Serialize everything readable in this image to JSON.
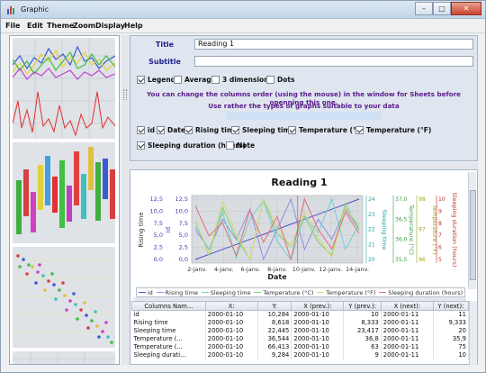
{
  "window": {
    "title": "Graphic",
    "minimize": "–",
    "maximize": "□",
    "close": "✕"
  },
  "menu": [
    "File",
    "Edit",
    "Theme",
    "Zoom",
    "Display",
    "Help"
  ],
  "form": {
    "title_label": "Title",
    "title_value": "Reading 1",
    "subtitle_label": "Subtitle",
    "subtitle_value": "",
    "options": [
      {
        "label": "Legend",
        "checked": true
      },
      {
        "label": "Average",
        "checked": false
      },
      {
        "label": "3 dimensions",
        "checked": false
      },
      {
        "label": "Dots",
        "checked": false
      }
    ],
    "info1": "You can change the columns order (using the mouse) in the window for Sheets before openning this one.",
    "info2": "Use rather the types of graphs suitable to your data",
    "columns": [
      {
        "label": "id",
        "checked": true
      },
      {
        "label": "Date",
        "checked": true
      },
      {
        "label": "Rising time",
        "checked": true
      },
      {
        "label": "Sleeping time",
        "checked": true
      },
      {
        "label": "Temperature (°C)",
        "checked": true
      },
      {
        "label": "Temperature (°F)",
        "checked": true
      },
      {
        "label": "Sleeping duration (hours)",
        "checked": true
      },
      {
        "label": "Note",
        "checked": false
      }
    ]
  },
  "chart_data": {
    "type": "line",
    "title": "Reading 1",
    "xlabel": "Date",
    "x": [
      "2-janv.",
      "4-janv.",
      "6-janv.",
      "8-janv.",
      "10-janv.",
      "12-janv.",
      "14-janv."
    ],
    "left_axes": [
      {
        "label": "Rising time",
        "ticks": [],
        "color": "#333"
      },
      {
        "label": "id",
        "ticks": [
          "0,0",
          "2,5",
          "5,0",
          "7,5",
          "10,0",
          "12,5"
        ],
        "color": "#3a3ab0"
      }
    ],
    "right_axes": [
      {
        "label": "Sleeping time",
        "ticks": [
          "20",
          "21",
          "22",
          "23",
          "24"
        ],
        "color": "#2aa0a0"
      },
      {
        "label": "Temperature (°C)",
        "ticks": [
          "35,5",
          "36,0",
          "36,5",
          "37,0"
        ],
        "color": "#3aa040"
      },
      {
        "label": "Temperature (°F)",
        "ticks": [
          "96",
          "97",
          "98"
        ],
        "color": "#a0a020"
      },
      {
        "label": "Sleeping duration (hours)",
        "ticks": [
          "5",
          "6",
          "7",
          "8",
          "9",
          "10"
        ],
        "color": "#c03030"
      }
    ],
    "series": [
      {
        "name": "id",
        "color": "#5050c8",
        "values": [
          0,
          1,
          2,
          3,
          4,
          5,
          6,
          7,
          8,
          9,
          10,
          11,
          12
        ]
      },
      {
        "name": "Rising time",
        "color": "#9090e0",
        "values": [
          8,
          6,
          9,
          7,
          10,
          5,
          8,
          11,
          6,
          9,
          7,
          10,
          8
        ]
      },
      {
        "name": "Sleeping time",
        "color": "#6fd0d0",
        "values": [
          22.4,
          21.0,
          23.2,
          20.5,
          22.8,
          23.9,
          21.5,
          20.4,
          23.0,
          22.0,
          24.0,
          21.0,
          22.5
        ]
      },
      {
        "name": "Temperature (°C)",
        "color": "#7fd07f",
        "values": [
          36.5,
          35.7,
          36.8,
          36.1,
          35.6,
          37.0,
          36.2,
          35.9,
          36.6,
          36.0,
          35.7,
          36.9,
          36.3
        ]
      },
      {
        "name": "Temperature (°F)",
        "color": "#d8d870",
        "values": [
          97.5,
          96.2,
          98.2,
          97.0,
          96.0,
          98.3,
          97.2,
          96.5,
          97.8,
          96.8,
          96.1,
          98.0,
          97.3
        ]
      },
      {
        "name": "Sleeping duration (hours)",
        "color": "#e07070",
        "values": [
          9.3,
          7.0,
          8.0,
          5.5,
          9.0,
          6.5,
          8.5,
          5.2,
          9.8,
          7.5,
          6.0,
          8.8,
          7.2
        ]
      }
    ]
  },
  "table": {
    "headers": [
      "Columns Nam...",
      "X:",
      "Y:",
      "X (prev.):",
      "Y (prev.):",
      "X (next):",
      "Y (next):"
    ],
    "rows": [
      [
        "id",
        "2000-01-10",
        "10,284",
        "2000-01-10",
        "10",
        "2000-01-11",
        "11"
      ],
      [
        "Rising time",
        "2000-01-10",
        "8,618",
        "2000-01-10",
        "8,333",
        "2000-01-11",
        "9,333"
      ],
      [
        "Sleeping time",
        "2000-01-10",
        "22,445",
        "2000-01-10",
        "23,417",
        "2000-01-11",
        "20"
      ],
      [
        "Temperature (...",
        "2000-01-10",
        "36,544",
        "2000-01-10",
        "36,8",
        "2000-01-11",
        "35,9"
      ],
      [
        "Temperature (...",
        "2000-01-10",
        "66,413",
        "2000-01-10",
        "63",
        "2000-01-11",
        "75"
      ],
      [
        "Sleeping durati...",
        "2000-01-10",
        "9,284",
        "2000-01-10",
        "9",
        "2000-01-11",
        "10"
      ]
    ]
  }
}
